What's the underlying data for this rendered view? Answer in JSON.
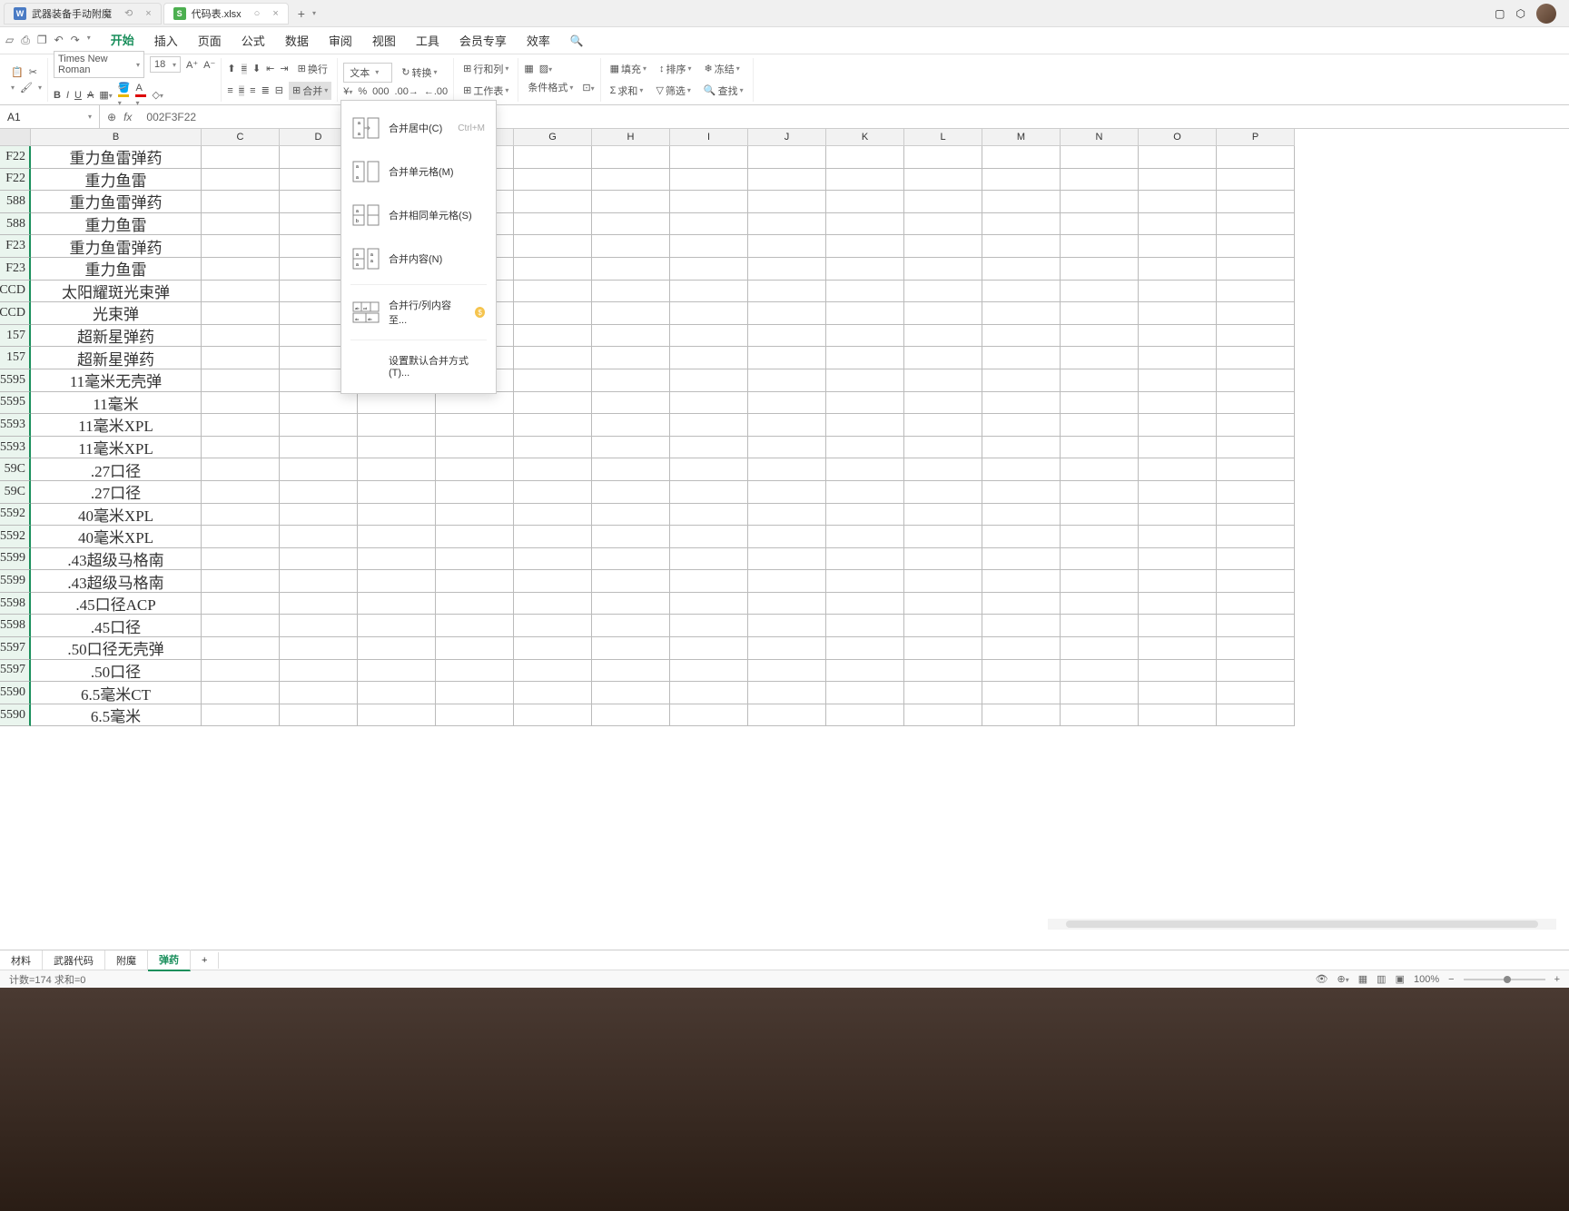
{
  "tabs": {
    "tab1": "武器装备手动附魔",
    "tab2": "代码表.xlsx"
  },
  "menu": {
    "start": "开始",
    "insert": "插入",
    "page": "页面",
    "formula": "公式",
    "data": "数据",
    "review": "审阅",
    "view": "视图",
    "tools": "工具",
    "member": "会员专享",
    "eff": "效率"
  },
  "ribbon": {
    "font": "Times New Roman",
    "size": "18",
    "wrap": "换行",
    "format_sel": "文本",
    "convert": "转换",
    "rowcol": "行和列",
    "freeze": "冻结",
    "fill": "填充",
    "sort": "排序",
    "merge": "合并",
    "worksheet": "工作表",
    "cond": "条件格式",
    "sum": "求和",
    "filter": "筛选",
    "find": "查找"
  },
  "formula": {
    "cell_ref": "A1",
    "content": "002F3F22"
  },
  "dropdown": {
    "item1": "合并居中(C)",
    "shortcut1": "Ctrl+M",
    "item2": "合并单元格(M)",
    "item3": "合并相同单元格(S)",
    "item4": "合并内容(N)",
    "item5": "合并行/列内容至...",
    "item6": "设置默认合并方式(T)..."
  },
  "columns": [
    "B",
    "C",
    "D",
    "",
    "",
    "G",
    "H",
    "I",
    "J",
    "K",
    "L",
    "M",
    "N",
    "O",
    "P"
  ],
  "rows": [
    {
      "a": "F22",
      "b": "重力鱼雷弹药"
    },
    {
      "a": "F22",
      "b": "重力鱼雷"
    },
    {
      "a": "588",
      "b": "重力鱼雷弹药"
    },
    {
      "a": "588",
      "b": "重力鱼雷"
    },
    {
      "a": "F23",
      "b": "重力鱼雷弹药"
    },
    {
      "a": "F23",
      "b": "重力鱼雷"
    },
    {
      "a": "CCD",
      "b": "太阳耀斑光束弹"
    },
    {
      "a": "CCD",
      "b": "光束弹"
    },
    {
      "a": "157",
      "b": "超新星弹药"
    },
    {
      "a": "157",
      "b": "超新星弹药"
    },
    {
      "a": "5595",
      "b": "11毫米无壳弹"
    },
    {
      "a": "5595",
      "b": "11毫米"
    },
    {
      "a": "5593",
      "b": "11毫米XPL"
    },
    {
      "a": "5593",
      "b": "11毫米XPL"
    },
    {
      "a": "59C",
      "b": ".27口径"
    },
    {
      "a": "59C",
      "b": ".27口径"
    },
    {
      "a": "5592",
      "b": "40毫米XPL"
    },
    {
      "a": "5592",
      "b": "40毫米XPL"
    },
    {
      "a": "5599",
      "b": ".43超级马格南"
    },
    {
      "a": "5599",
      "b": ".43超级马格南"
    },
    {
      "a": "5598",
      "b": ".45口径ACP"
    },
    {
      "a": "5598",
      "b": ".45口径"
    },
    {
      "a": "5597",
      "b": ".50口径无壳弹"
    },
    {
      "a": "5597",
      "b": ".50口径"
    },
    {
      "a": "5590",
      "b": "6.5毫米CT"
    },
    {
      "a": "5590",
      "b": "6.5毫米"
    }
  ],
  "sheets": {
    "s1": "材料",
    "s2": "武器代码",
    "s3": "附魔",
    "s4": "弹药"
  },
  "status": {
    "left": "计数=174  求和=0",
    "zoom": "100%"
  }
}
